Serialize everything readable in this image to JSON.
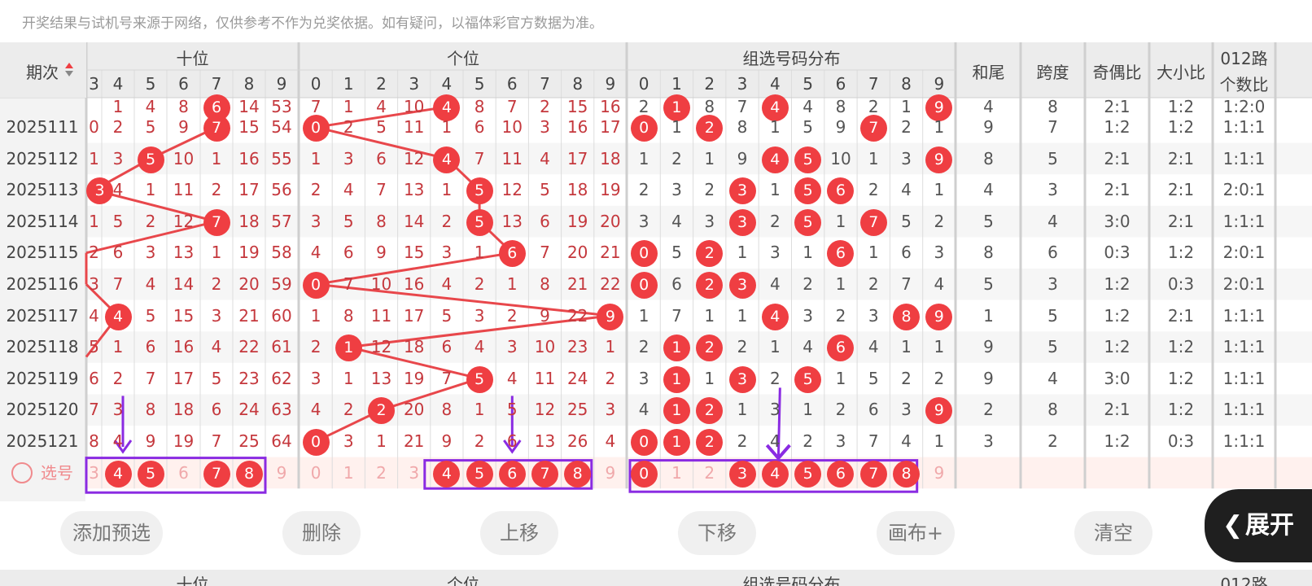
{
  "notice": "开奖结果与试机号来源于网络，仅供参考不作为兑奖依据。如有疑问，以福体彩官方数据为准。",
  "headers": {
    "issue": "期次",
    "tens": "十位",
    "units": "个位",
    "group": "组选号码分布",
    "hewei": "和尾",
    "kuadu": "跨度",
    "jiou": "奇偶比",
    "daxiao": "大小比",
    "lu012_line1": "012路",
    "lu012_line2": "个数比"
  },
  "tens_digits": [
    "4",
    "5",
    "6",
    "7",
    "8",
    "9"
  ],
  "tens_partial_digit": "3",
  "digits": [
    "0",
    "1",
    "2",
    "3",
    "4",
    "5",
    "6",
    "7",
    "8",
    "9"
  ],
  "partial_row": {
    "tens": [
      "",
      "1",
      "4",
      "8",
      "6",
      "14",
      "53"
    ],
    "units": [
      "7",
      "1",
      "4",
      "10",
      "4",
      "8",
      "7",
      "2",
      "15",
      "16"
    ],
    "group": [
      "2",
      "1",
      "8",
      "7",
      "4",
      "4",
      "8",
      "2",
      "1",
      "9"
    ],
    "hewei": "4",
    "kuadu": "8",
    "jiou": "2:1",
    "daxiao": "1:2",
    "lu012": "1:2:0",
    "tens_hit": 4,
    "units_hit": 4,
    "group_hits": [
      1,
      4,
      9
    ]
  },
  "rows": [
    {
      "issue": "2025111",
      "tens": [
        "0",
        "2",
        "5",
        "9",
        "7",
        "15",
        "54"
      ],
      "tens_hit": 4,
      "units": [
        "0",
        "2",
        "5",
        "11",
        "1",
        "6",
        "10",
        "3",
        "16",
        "17"
      ],
      "units_hit": 0,
      "group": [
        "0",
        "1",
        "2",
        "8",
        "1",
        "5",
        "9",
        "7",
        "2",
        "1"
      ],
      "group_hits": [
        0,
        2,
        7
      ],
      "hewei": "9",
      "kuadu": "7",
      "jiou": "1:2",
      "daxiao": "1:2",
      "lu012": "1:1:1"
    },
    {
      "issue": "2025112",
      "tens": [
        "1",
        "3",
        "5",
        "10",
        "1",
        "16",
        "55"
      ],
      "tens_hit": 2,
      "units": [
        "1",
        "3",
        "6",
        "12",
        "4",
        "7",
        "11",
        "4",
        "17",
        "18"
      ],
      "units_hit": 4,
      "group": [
        "1",
        "2",
        "1",
        "9",
        "4",
        "5",
        "10",
        "1",
        "3",
        "9"
      ],
      "group_hits": [
        4,
        5,
        9
      ],
      "hewei": "8",
      "kuadu": "5",
      "jiou": "2:1",
      "daxiao": "2:1",
      "lu012": "1:1:1"
    },
    {
      "issue": "2025113",
      "tens": [
        "3",
        "4",
        "1",
        "11",
        "2",
        "17",
        "56"
      ],
      "tens_hit": 0,
      "units": [
        "2",
        "4",
        "7",
        "13",
        "1",
        "5",
        "12",
        "5",
        "18",
        "19"
      ],
      "units_hit": 5,
      "group": [
        "2",
        "3",
        "2",
        "3",
        "1",
        "5",
        "6",
        "2",
        "4",
        "1"
      ],
      "group_hits": [
        3,
        5,
        6
      ],
      "hewei": "4",
      "kuadu": "3",
      "jiou": "2:1",
      "daxiao": "2:1",
      "lu012": "2:0:1"
    },
    {
      "issue": "2025114",
      "tens": [
        "1",
        "5",
        "2",
        "12",
        "7",
        "18",
        "57"
      ],
      "tens_hit": 4,
      "units": [
        "3",
        "5",
        "8",
        "14",
        "2",
        "5",
        "13",
        "6",
        "19",
        "20"
      ],
      "units_hit": 5,
      "group": [
        "3",
        "4",
        "3",
        "3",
        "2",
        "5",
        "1",
        "7",
        "5",
        "2"
      ],
      "group_hits": [
        3,
        5,
        7
      ],
      "hewei": "5",
      "kuadu": "4",
      "jiou": "3:0",
      "daxiao": "2:1",
      "lu012": "1:1:1"
    },
    {
      "issue": "2025115",
      "tens": [
        "2",
        "6",
        "3",
        "13",
        "1",
        "19",
        "58"
      ],
      "tens_hit": -1,
      "units": [
        "4",
        "6",
        "9",
        "15",
        "3",
        "1",
        "6",
        "7",
        "20",
        "21"
      ],
      "units_hit": 6,
      "group": [
        "0",
        "5",
        "2",
        "1",
        "3",
        "1",
        "6",
        "1",
        "6",
        "3"
      ],
      "group_hits": [
        0,
        2,
        6
      ],
      "hewei": "8",
      "kuadu": "6",
      "jiou": "0:3",
      "daxiao": "1:2",
      "lu012": "2:0:1"
    },
    {
      "issue": "2025116",
      "tens": [
        "3",
        "7",
        "4",
        "14",
        "2",
        "20",
        "59"
      ],
      "tens_hit": -1,
      "units": [
        "0",
        "7",
        "10",
        "16",
        "4",
        "2",
        "1",
        "8",
        "21",
        "22"
      ],
      "units_hit": 0,
      "group": [
        "0",
        "6",
        "2",
        "3",
        "4",
        "2",
        "1",
        "2",
        "7",
        "4"
      ],
      "group_hits": [
        0,
        2,
        3
      ],
      "hewei": "5",
      "kuadu": "3",
      "jiou": "1:2",
      "daxiao": "0:3",
      "lu012": "2:0:1"
    },
    {
      "issue": "2025117",
      "tens": [
        "4",
        "4",
        "5",
        "15",
        "3",
        "21",
        "60"
      ],
      "tens_hit": 1,
      "units": [
        "1",
        "8",
        "11",
        "17",
        "5",
        "3",
        "2",
        "9",
        "22",
        "9"
      ],
      "units_hit": 9,
      "group": [
        "1",
        "7",
        "1",
        "1",
        "4",
        "3",
        "2",
        "3",
        "8",
        "9"
      ],
      "group_hits": [
        4,
        8,
        9
      ],
      "hewei": "1",
      "kuadu": "5",
      "jiou": "1:2",
      "daxiao": "2:1",
      "lu012": "1:1:1"
    },
    {
      "issue": "2025118",
      "tens": [
        "5",
        "1",
        "6",
        "16",
        "4",
        "22",
        "61"
      ],
      "tens_hit": -1,
      "units": [
        "2",
        "1",
        "12",
        "18",
        "6",
        "4",
        "3",
        "10",
        "23",
        "1"
      ],
      "units_hit": 1,
      "group": [
        "2",
        "1",
        "2",
        "2",
        "1",
        "4",
        "6",
        "4",
        "1",
        "1"
      ],
      "group_hits": [
        1,
        2,
        6
      ],
      "hewei": "9",
      "kuadu": "5",
      "jiou": "1:2",
      "daxiao": "1:2",
      "lu012": "1:1:1"
    },
    {
      "issue": "2025119",
      "tens": [
        "6",
        "2",
        "7",
        "17",
        "5",
        "23",
        "62"
      ],
      "tens_hit": -1,
      "units": [
        "3",
        "1",
        "13",
        "19",
        "7",
        "5",
        "4",
        "11",
        "24",
        "2"
      ],
      "units_hit": 5,
      "group": [
        "3",
        "1",
        "1",
        "3",
        "2",
        "5",
        "1",
        "5",
        "2",
        "2"
      ],
      "group_hits": [
        1,
        3,
        5
      ],
      "hewei": "9",
      "kuadu": "4",
      "jiou": "3:0",
      "daxiao": "1:2",
      "lu012": "1:1:1"
    },
    {
      "issue": "2025120",
      "tens": [
        "7",
        "3",
        "8",
        "18",
        "6",
        "24",
        "63"
      ],
      "tens_hit": -1,
      "units": [
        "4",
        "2",
        "2",
        "20",
        "8",
        "1",
        "5",
        "12",
        "25",
        "3"
      ],
      "units_hit": 2,
      "group": [
        "4",
        "1",
        "2",
        "1",
        "3",
        "1",
        "2",
        "6",
        "3",
        "9"
      ],
      "group_hits": [
        1,
        2,
        9
      ],
      "hewei": "2",
      "kuadu": "8",
      "jiou": "2:1",
      "daxiao": "1:2",
      "lu012": "1:1:1"
    },
    {
      "issue": "2025121",
      "tens": [
        "8",
        "4",
        "9",
        "19",
        "7",
        "25",
        "64"
      ],
      "tens_hit": -1,
      "units": [
        "0",
        "3",
        "1",
        "21",
        "9",
        "2",
        "6",
        "13",
        "26",
        "4"
      ],
      "units_hit": 0,
      "group": [
        "0",
        "1",
        "2",
        "2",
        "4",
        "2",
        "3",
        "7",
        "4",
        "1"
      ],
      "group_hits": [
        0,
        1,
        2
      ],
      "hewei": "3",
      "kuadu": "2",
      "jiou": "1:2",
      "daxiao": "0:3",
      "lu012": "1:1:1"
    }
  ],
  "select_row": {
    "label": "选号",
    "tens": [
      "3",
      "4",
      "5",
      "6",
      "7",
      "8",
      "9"
    ],
    "tens_sel": [
      1,
      2,
      4,
      5
    ],
    "units": [
      "0",
      "1",
      "2",
      "3",
      "4",
      "5",
      "6",
      "7",
      "8",
      "9"
    ],
    "units_sel": [
      4,
      5,
      6,
      7,
      8
    ],
    "group": [
      "0",
      "1",
      "2",
      "3",
      "4",
      "5",
      "6",
      "7",
      "8",
      "9"
    ],
    "group_sel": [
      0,
      3,
      4,
      5,
      6,
      7,
      8
    ]
  },
  "toolbar": {
    "add": "添加预选",
    "delete": "删除",
    "up": "上移",
    "down": "下移",
    "canvas": "画布+",
    "clear": "清空",
    "expand": "展开"
  },
  "colors": {
    "accent": "#ef3e42",
    "line": "#e8474b",
    "annotation": "#8a2be2",
    "header_bg": "#ececec",
    "select_bg": "#fff1ee"
  }
}
